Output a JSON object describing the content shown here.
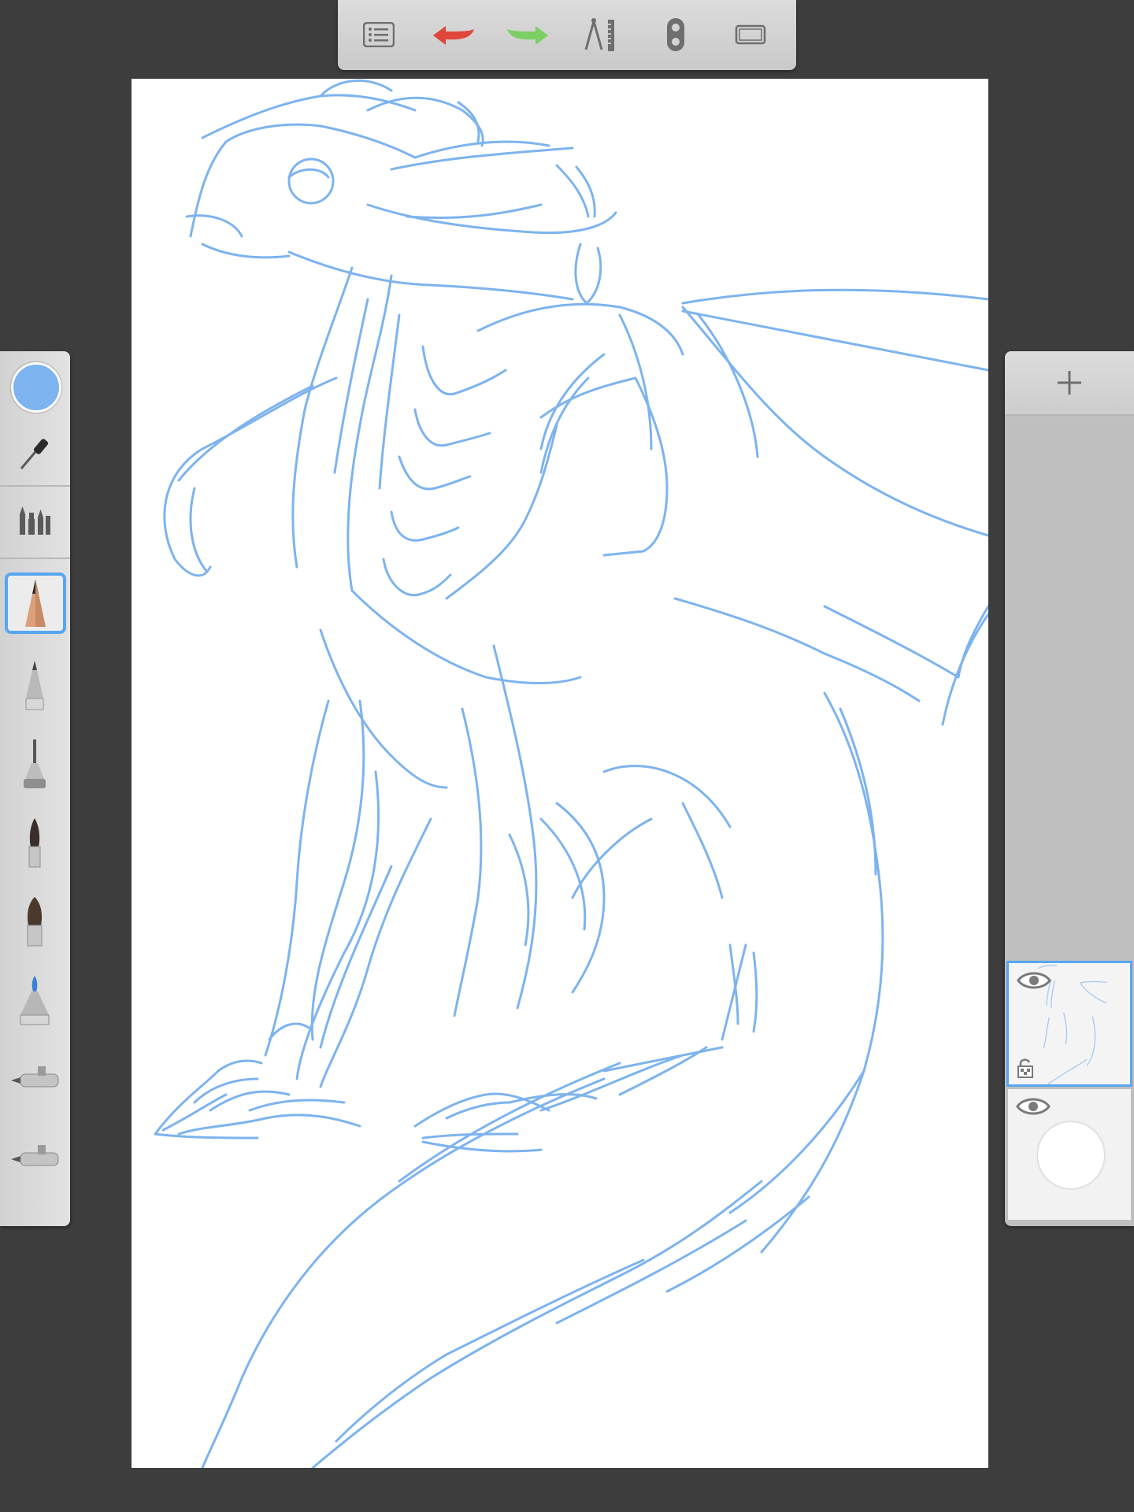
{
  "app": {
    "accent_color": "#57a6f0",
    "current_color": "#7db3ee"
  },
  "top_toolbar": {
    "buttons": [
      {
        "name": "menu-list",
        "icon": "list-icon"
      },
      {
        "name": "undo",
        "icon": "undo-arrow-icon",
        "color": "#e0463a"
      },
      {
        "name": "redo",
        "icon": "redo-arrow-icon",
        "color": "#7ccf62"
      },
      {
        "name": "guides",
        "icon": "compass-ruler-icon"
      },
      {
        "name": "symmetry",
        "icon": "symmetry-icon"
      },
      {
        "name": "fullscreen",
        "icon": "fullscreen-frame-icon"
      }
    ]
  },
  "left_palette": {
    "items": [
      {
        "name": "color-swatch",
        "icon": "color-circle"
      },
      {
        "name": "eyedropper",
        "icon": "eyedropper-icon"
      },
      {
        "name": "brush-library",
        "icon": "brush-library-icon"
      },
      {
        "name": "pencil",
        "icon": "pencil-icon",
        "selected": true
      },
      {
        "name": "ballpoint-pen",
        "icon": "ballpoint-pen-icon"
      },
      {
        "name": "fine-liner",
        "icon": "fineliner-icon"
      },
      {
        "name": "round-brush",
        "icon": "round-brush-icon"
      },
      {
        "name": "flat-brush",
        "icon": "flat-brush-icon"
      },
      {
        "name": "marker",
        "icon": "marker-icon"
      },
      {
        "name": "airbrush",
        "icon": "airbrush-icon"
      },
      {
        "name": "airbrush-2",
        "icon": "airbrush-icon"
      }
    ]
  },
  "layer_panel": {
    "add_icon": "plus-icon",
    "layers": [
      {
        "name": "sketch-layer",
        "visible": true,
        "locked": false,
        "selected": true
      },
      {
        "name": "background-layer",
        "visible": true,
        "selected": false
      }
    ]
  },
  "canvas": {
    "background": "#ffffff",
    "stroke_color": "#7db3ee",
    "subject": "dragon sketch"
  }
}
